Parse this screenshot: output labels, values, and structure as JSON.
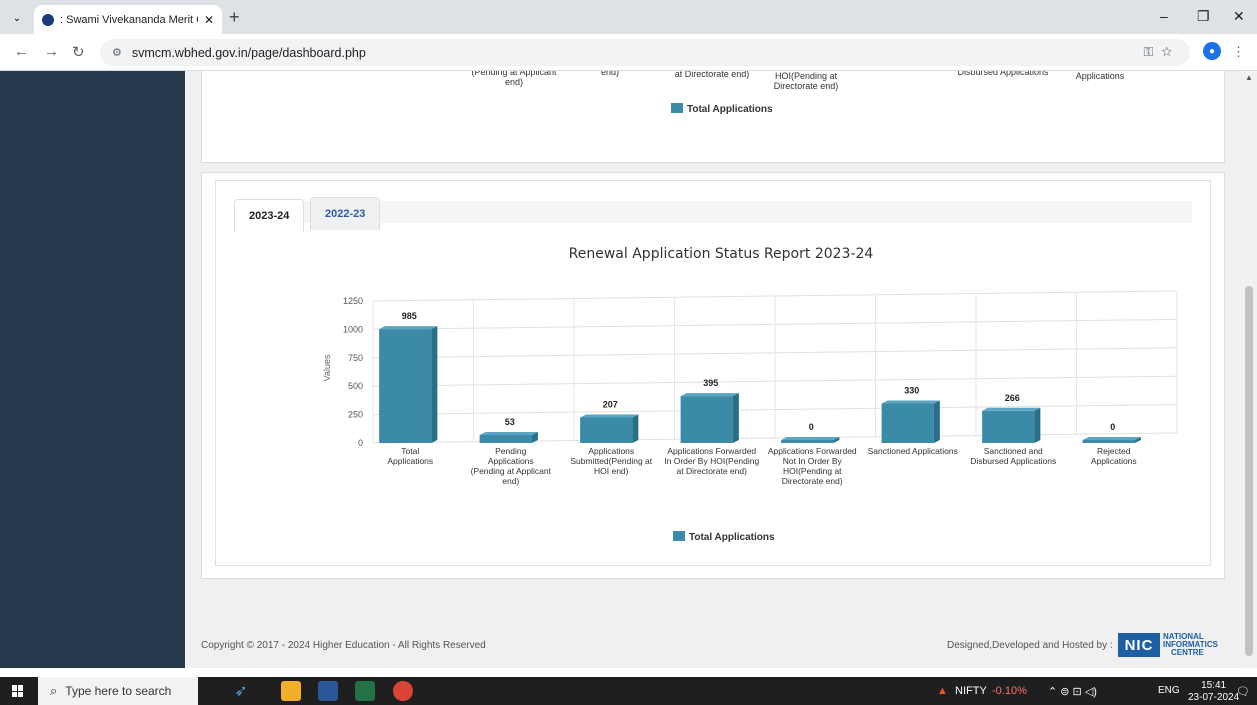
{
  "browser": {
    "tab_title": ": Swami Vivekananda Merit Cur",
    "url": "svmcm.wbhed.gov.in/page/dashboard.php"
  },
  "top_chart_partial": {
    "labels": [
      "(Pending at Applicant\nend)",
      "end)",
      "at Directorate end)",
      "HOI(Pending at\nDirectorate end)",
      "Disbursed Applications",
      "Applications"
    ],
    "legend": "Total Applications",
    "accent": "#3b8aa8"
  },
  "year_tabs": [
    {
      "label": "2023-24",
      "active": true
    },
    {
      "label": "2022-23",
      "active": false
    }
  ],
  "chart_data": {
    "type": "bar",
    "title": "Renewal Application Status Report 2023-24",
    "ylabel": "Values",
    "ylim": [
      0,
      1250
    ],
    "yticks": [
      "0",
      "250",
      "500",
      "750",
      "1000",
      "1250"
    ],
    "categories": [
      "Total\nApplications",
      "Pending\nApplications\n(Pending at Applicant\nend)",
      "Applications\nSubmitted(Pending at\nHOI end)",
      "Applications Forwarded\nIn Order By HOI(Pending\nat Directorate end)",
      "Applications Forwarded\nNot In Order By\nHOI(Pending at\nDirectorate end)",
      "Sanctioned Applications",
      "Sanctioned and\nDisbursed Applications",
      "Rejected\nApplications"
    ],
    "values": [
      985,
      53,
      207,
      395,
      0,
      330,
      266,
      0
    ],
    "value_labels": [
      "985",
      "53",
      "207",
      "395",
      "0",
      "330",
      "266",
      "0"
    ],
    "series": [
      {
        "name": "Total Applications",
        "color": "#3b8aa8"
      }
    ],
    "legend": "Total Applications",
    "grid": true
  },
  "footer": {
    "copyright": "Copyright © 2017 - 2024 Higher Education - All Rights Reserved",
    "designed": "Designed,Developed and Hosted by :",
    "nic_box": "NIC",
    "nic_text_1": "NATIONAL",
    "nic_text_2": "INFORMATICS",
    "nic_text_3": "CENTRE"
  },
  "taskbar": {
    "search_placeholder": "Type here to search",
    "market": "NIFTY",
    "market_change": "-0.10%",
    "lang": "ENG",
    "time": "15:41",
    "date": "23-07-2024"
  }
}
